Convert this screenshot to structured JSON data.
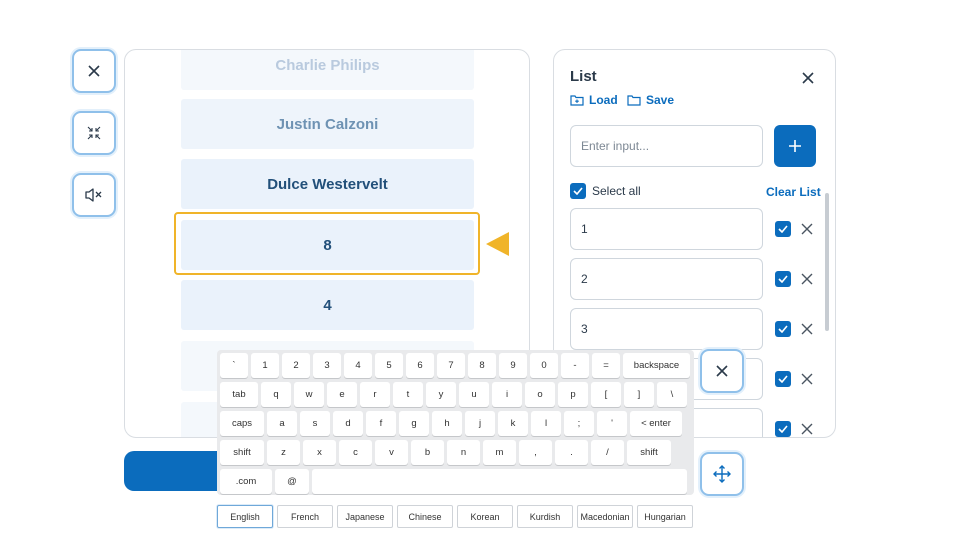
{
  "controls": {
    "close_icon": "close-icon",
    "collapse_icon": "collapse-arrows-icon",
    "mute_icon": "speaker-mute-icon"
  },
  "wheel": {
    "items": [
      "Charlie Philips",
      "Justin Calzoni",
      "Dulce Westervelt",
      "8",
      "4"
    ],
    "selected": "8"
  },
  "list_panel": {
    "title": "List",
    "load_label": "Load",
    "save_label": "Save",
    "input_placeholder": "Enter input...",
    "select_all_label": "Select all",
    "clear_label": "Clear List",
    "items": [
      "1",
      "2",
      "3",
      "",
      ""
    ]
  },
  "keyboard": {
    "rows": [
      [
        "`",
        "1",
        "2",
        "3",
        "4",
        "5",
        "6",
        "7",
        "8",
        "9",
        "0",
        "-",
        "=",
        "backspace"
      ],
      [
        "tab",
        "q",
        "w",
        "e",
        "r",
        "t",
        "y",
        "u",
        "i",
        "o",
        "p",
        "[",
        "]",
        "\\"
      ],
      [
        "caps",
        "a",
        "s",
        "d",
        "f",
        "g",
        "h",
        "j",
        "k",
        "l",
        ";",
        "'",
        "< enter"
      ],
      [
        "shift",
        "z",
        "x",
        "c",
        "v",
        "b",
        "n",
        "m",
        ",",
        ".",
        "/",
        "shift"
      ],
      [
        ".com",
        "@",
        ""
      ]
    ],
    "languages": [
      "English",
      "French",
      "Japanese",
      "Chinese",
      "Korean",
      "Kurdish",
      "Macedonian",
      "Hungarian"
    ],
    "active_language": "English"
  },
  "colors": {
    "accent": "#0b6cbd",
    "highlight": "#f0b429",
    "item_bg": "#eaf2fb"
  }
}
